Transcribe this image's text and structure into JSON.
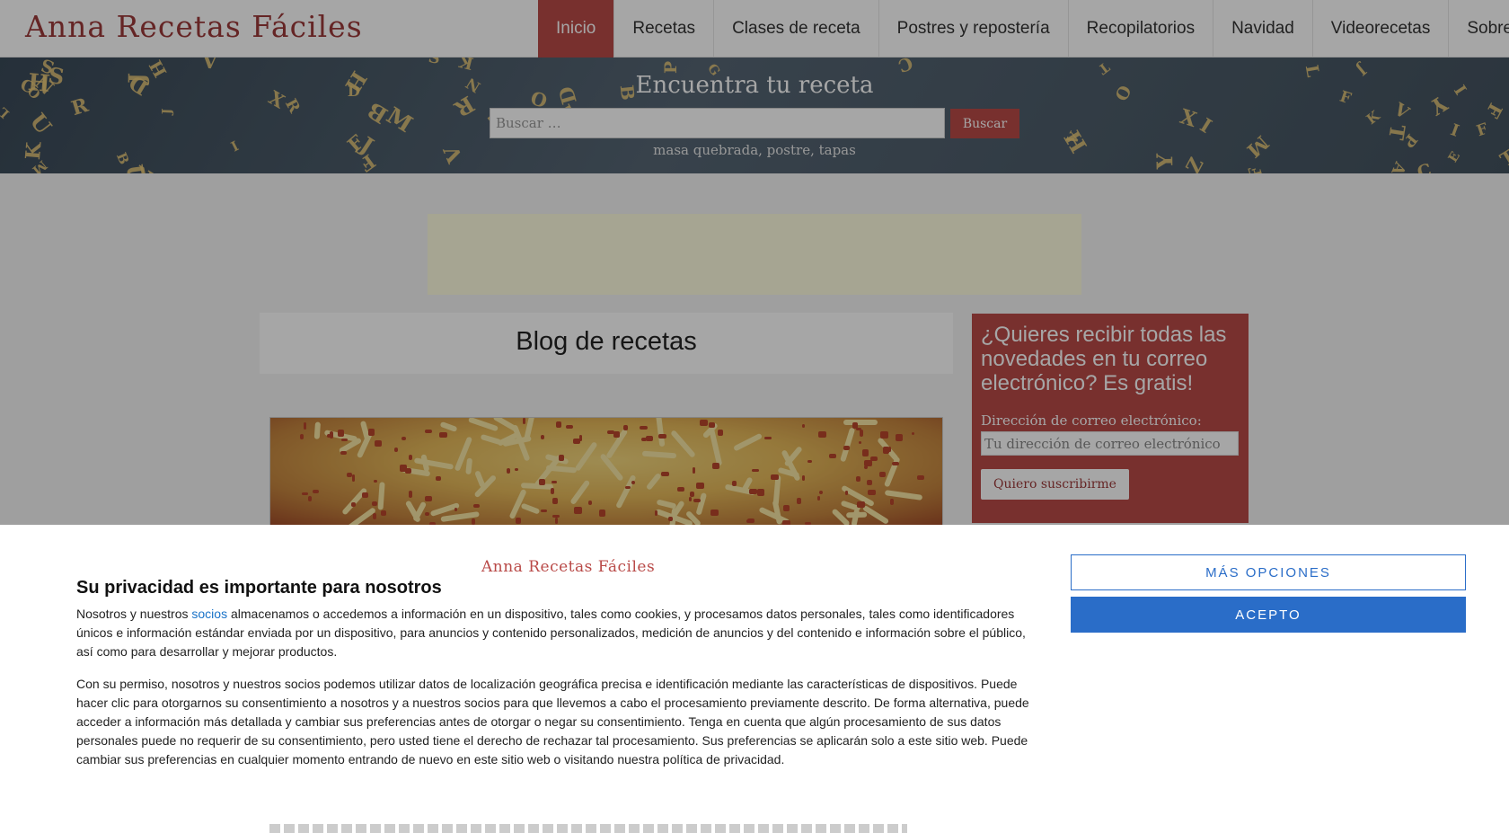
{
  "site": {
    "logo": "Anna Recetas Fáciles"
  },
  "nav": {
    "items": [
      {
        "label": "Inicio",
        "active": true
      },
      {
        "label": "Recetas"
      },
      {
        "label": "Clases de receta"
      },
      {
        "label": "Postres y repostería"
      },
      {
        "label": "Recopilatorios"
      },
      {
        "label": "Navidad"
      },
      {
        "label": "Videorecetas"
      },
      {
        "label": "Sobre mí"
      }
    ]
  },
  "hero": {
    "title": "Encuentra tu receta",
    "search_placeholder": "Buscar …",
    "search_button": "Buscar",
    "hint": "masa quebrada, postre, tapas"
  },
  "main": {
    "blog_title": "Blog de recetas"
  },
  "subscribe": {
    "title": "¿Quieres recibir todas las novedades en tu correo electrónico? Es gratis!",
    "email_label": "Dirección de correo electrónico:",
    "email_placeholder": "Tu dirección de correo electrónico",
    "button": "Quiero suscribirme"
  },
  "consent": {
    "brand": "Anna Recetas Fáciles",
    "heading": "Su privacidad es importante para nosotros",
    "p1_before": "Nosotros y nuestros ",
    "p1_link": "socios",
    "p1_after": " almacenamos o accedemos a información en un dispositivo, tales como cookies, y procesamos datos personales, tales como identificadores únicos e información estándar enviada por un dispositivo, para anuncios y contenido personalizados, medición de anuncios y del contenido e información sobre el público, así como para desarrollar y mejorar productos.",
    "p2": "Con su permiso, nosotros y nuestros socios podemos utilizar datos de localización geográfica precisa e identificación mediante las características de dispositivos. Puede hacer clic para otorgarnos su consentimiento a nosotros y a nuestros socios para que llevemos a cabo el procesamiento previamente descrito. De forma alternativa, puede acceder a información más detallada y cambiar sus preferencias antes de otorgar o negar su consentimiento. Tenga en cuenta que algún procesamiento de sus datos personales puede no requerir de su consentimiento, pero usted tiene el derecho de rechazar tal procesamiento. Sus preferencias se aplicarán solo a este sitio web. Puede cambiar sus preferencias en cualquier momento entrando de nuevo en este sitio web o visitando nuestra política de privacidad.",
    "more_button": "MÁS OPCIONES",
    "accept_button": "ACEPTO"
  },
  "colors": {
    "brand": "#b94a48",
    "link": "#1a73c8",
    "accept": "#2a6dc8"
  }
}
